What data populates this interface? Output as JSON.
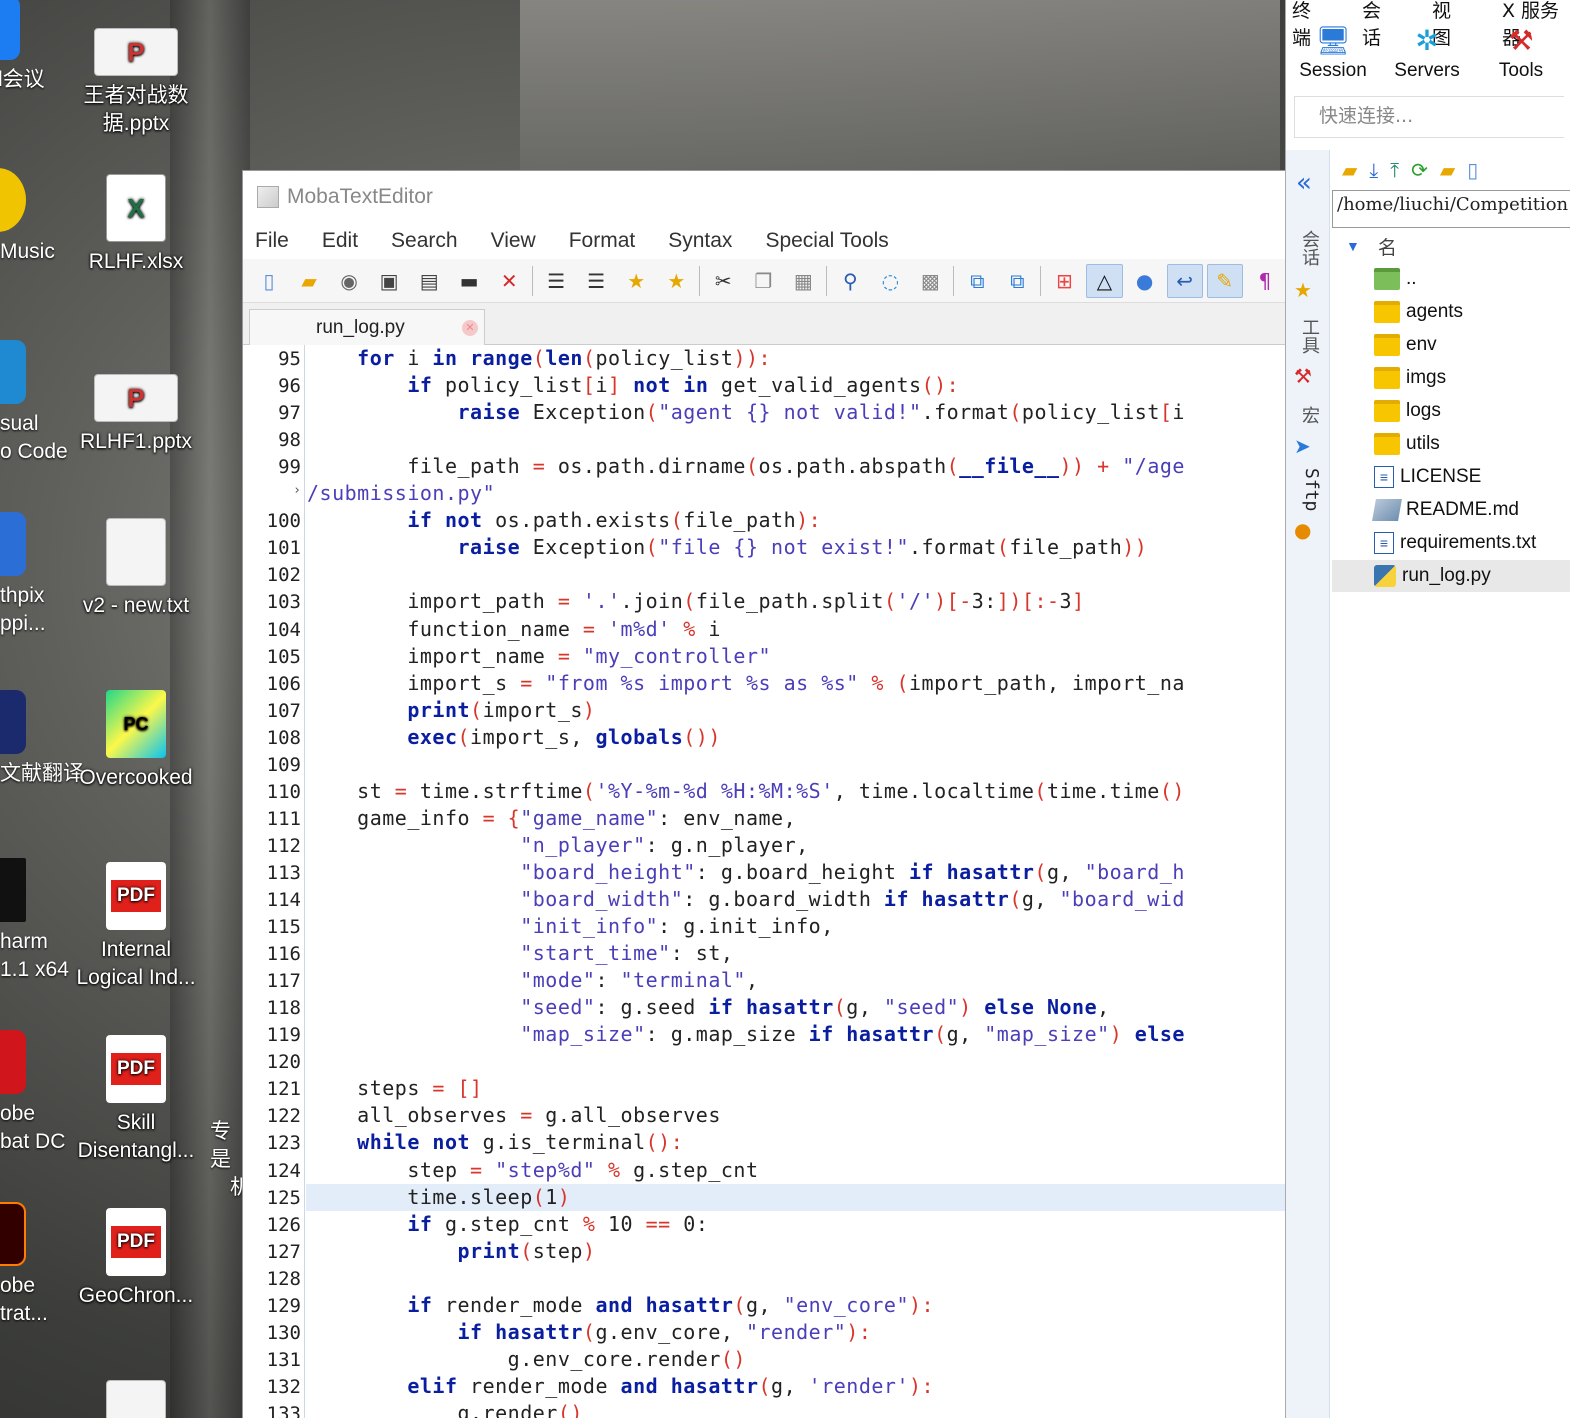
{
  "desktop": {
    "icons": [
      {
        "label": "王者对战数据.pptx",
        "type": "pptx"
      },
      {
        "label": "RLHF.xlsx",
        "type": "xlsx"
      },
      {
        "label": "RLHF1.pptx",
        "type": "pptx"
      },
      {
        "label": "v2 - new.txt",
        "type": "txt"
      },
      {
        "label": "Overcooked",
        "type": "app"
      },
      {
        "label": "Internal Logical Ind...",
        "type": "pdf"
      },
      {
        "label": "Skill Disentangl...",
        "type": "pdf"
      },
      {
        "label": "GeoChron...",
        "type": "pdf"
      }
    ],
    "left_partial": [
      "l会议",
      "Music",
      "sual",
      "o Code",
      "thpix",
      "ppi...",
      "文献翻译",
      "harm",
      "1.1 x64",
      "obe",
      "bat DC",
      "obe",
      "trat..."
    ],
    "misc_partial": [
      "专是",
      "机"
    ]
  },
  "editor": {
    "title": "MobaTextEditor",
    "menu": [
      "File",
      "Edit",
      "Search",
      "View",
      "Format",
      "Syntax",
      "Special Tools"
    ],
    "tab": "run_log.py",
    "highlight_line": 125,
    "lines": [
      {
        "n": "95",
        "html": "    <span class='k'>for</span> i <span class='k'>in</span> <span class='k'>range</span><span class='o'>(</span><span class='k'>len</span><span class='o'>(</span>policy_list<span class='o'>)):</span>"
      },
      {
        "n": "96",
        "html": "        <span class='k'>if</span> policy_list<span class='o'>[</span>i<span class='o'>]</span> <span class='k'>not in</span> get_valid_agents<span class='o'>():</span>"
      },
      {
        "n": "97",
        "html": "            <span class='k'>raise</span> Exception<span class='o'>(</span><span class='s'>\"agent {} not valid!\"</span>.format<span class='o'>(</span>policy_list<span class='o'>[</span>i"
      },
      {
        "n": "98",
        "html": ""
      },
      {
        "n": "99",
        "html": "        file_path <span class='o'>=</span> os.path.dirname<span class='o'>(</span>os.path.abspath<span class='o'>(</span><span class='k'>__file__</span><span class='o'>))</span> <span class='o'>+</span> <span class='s'>\"/age</span>"
      },
      {
        "n": "",
        "html": "<span class='s'>/submission.py\"</span>"
      },
      {
        "n": "100",
        "html": "        <span class='k'>if not</span> os.path.exists<span class='o'>(</span>file_path<span class='o'>):</span>"
      },
      {
        "n": "101",
        "html": "            <span class='k'>raise</span> Exception<span class='o'>(</span><span class='s'>\"file {} not exist!\"</span>.format<span class='o'>(</span>file_path<span class='o'>))</span>"
      },
      {
        "n": "102",
        "html": ""
      },
      {
        "n": "103",
        "html": "        import_path <span class='o'>=</span> <span class='s'>'.'</span>.join<span class='o'>(</span>file_path.split<span class='o'>(</span><span class='s'>'/'</span><span class='o'>)[-</span>3:<span class='o'>])[:-</span>3<span class='o'>]</span>"
      },
      {
        "n": "104",
        "html": "        function_name <span class='o'>=</span> <span class='s'>'m%d'</span> <span class='o'>%</span> i"
      },
      {
        "n": "105",
        "html": "        import_name <span class='o'>=</span> <span class='s'>\"my_controller\"</span>"
      },
      {
        "n": "106",
        "html": "        import_s <span class='o'>=</span> <span class='s'>\"from %s import %s as %s\"</span> <span class='o'>%</span> <span class='o'>(</span>import_path, import_na"
      },
      {
        "n": "107",
        "html": "        <span class='k'>print</span><span class='o'>(</span>import_s<span class='o'>)</span>"
      },
      {
        "n": "108",
        "html": "        <span class='k'>exec</span><span class='o'>(</span>import_s, <span class='k'>globals</span><span class='o'>())</span>"
      },
      {
        "n": "109",
        "html": ""
      },
      {
        "n": "110",
        "html": "    st <span class='o'>=</span> time.strftime<span class='o'>(</span><span class='s'>'%Y-%m-%d %H:%M:%S'</span>, time.localtime<span class='o'>(</span>time.time<span class='o'>()</span>"
      },
      {
        "n": "111",
        "html": "    game_info <span class='o'>=</span> <span class='o'>{</span><span class='s'>\"game_name\"</span>: env_name,"
      },
      {
        "n": "112",
        "html": "                 <span class='s'>\"n_player\"</span>: g.n_player,"
      },
      {
        "n": "113",
        "html": "                 <span class='s'>\"board_height\"</span>: g.board_height <span class='k'>if hasattr</span><span class='o'>(</span>g, <span class='s'>\"board_h</span>"
      },
      {
        "n": "114",
        "html": "                 <span class='s'>\"board_width\"</span>: g.board_width <span class='k'>if hasattr</span><span class='o'>(</span>g, <span class='s'>\"board_wid</span>"
      },
      {
        "n": "115",
        "html": "                 <span class='s'>\"init_info\"</span>: g.init_info,"
      },
      {
        "n": "116",
        "html": "                 <span class='s'>\"start_time\"</span>: st,"
      },
      {
        "n": "117",
        "html": "                 <span class='s'>\"mode\"</span>: <span class='s'>\"terminal\"</span>,"
      },
      {
        "n": "118",
        "html": "                 <span class='s'>\"seed\"</span>: g.seed <span class='k'>if hasattr</span><span class='o'>(</span>g, <span class='s'>\"seed\"</span><span class='o'>)</span> <span class='k'>else None</span>,"
      },
      {
        "n": "119",
        "html": "                 <span class='s'>\"map_size\"</span>: g.map_size <span class='k'>if hasattr</span><span class='o'>(</span>g, <span class='s'>\"map_size\"</span><span class='o'>)</span> <span class='k'>else</span>"
      },
      {
        "n": "120",
        "html": ""
      },
      {
        "n": "121",
        "html": "    steps <span class='o'>= []</span>"
      },
      {
        "n": "122",
        "html": "    all_observes <span class='o'>=</span> g.all_observes"
      },
      {
        "n": "123",
        "html": "    <span class='k'>while not</span> g.is_terminal<span class='o'>():</span>"
      },
      {
        "n": "124",
        "html": "        step <span class='o'>=</span> <span class='s'>\"step%d\"</span> <span class='o'>%</span> g.step_cnt"
      },
      {
        "n": "125",
        "html": "        time.sleep<span class='o'>(</span>1<span class='o'>)</span>"
      },
      {
        "n": "126",
        "html": "        <span class='k'>if</span> g.step_cnt <span class='o'>%</span> 10 <span class='o'>==</span> 0:"
      },
      {
        "n": "127",
        "html": "            <span class='k'>print</span><span class='o'>(</span>step<span class='o'>)</span>"
      },
      {
        "n": "128",
        "html": ""
      },
      {
        "n": "129",
        "html": "        <span class='k'>if</span> render_mode <span class='k'>and hasattr</span><span class='o'>(</span>g, <span class='s'>\"env_core\"</span><span class='o'>):</span>"
      },
      {
        "n": "130",
        "html": "            <span class='k'>if hasattr</span><span class='o'>(</span>g.env_core, <span class='s'>\"render\"</span><span class='o'>):</span>"
      },
      {
        "n": "131",
        "html": "                g.env_core.render<span class='o'>()</span>"
      },
      {
        "n": "132",
        "html": "        <span class='k'>elif</span> render_mode <span class='k'>and hasattr</span><span class='o'>(</span>g, <span class='s'>'render'</span><span class='o'>):</span>"
      },
      {
        "n": "133",
        "html": "            g.render<span class='o'>()</span>"
      }
    ]
  },
  "mobaxterm": {
    "menu": [
      "终端",
      "会话",
      "视图",
      "X 服务器"
    ],
    "buttons": [
      "Session",
      "Servers",
      "Tools"
    ],
    "quick_connect_placeholder": "快速连接...",
    "side_tabs": [
      "会话",
      "工具",
      "宏",
      "Sftp"
    ],
    "path": "/home/liuchi/Competition",
    "tree_header": "名",
    "tree": [
      {
        "name": "..",
        "kind": "up"
      },
      {
        "name": "agents",
        "kind": "folder"
      },
      {
        "name": "env",
        "kind": "folder"
      },
      {
        "name": "imgs",
        "kind": "folder"
      },
      {
        "name": "logs",
        "kind": "folder"
      },
      {
        "name": "utils",
        "kind": "folder"
      },
      {
        "name": "LICENSE",
        "kind": "file"
      },
      {
        "name": "README.md",
        "kind": "md"
      },
      {
        "name": "requirements.txt",
        "kind": "file"
      },
      {
        "name": "run_log.py",
        "kind": "py",
        "selected": true
      }
    ]
  }
}
